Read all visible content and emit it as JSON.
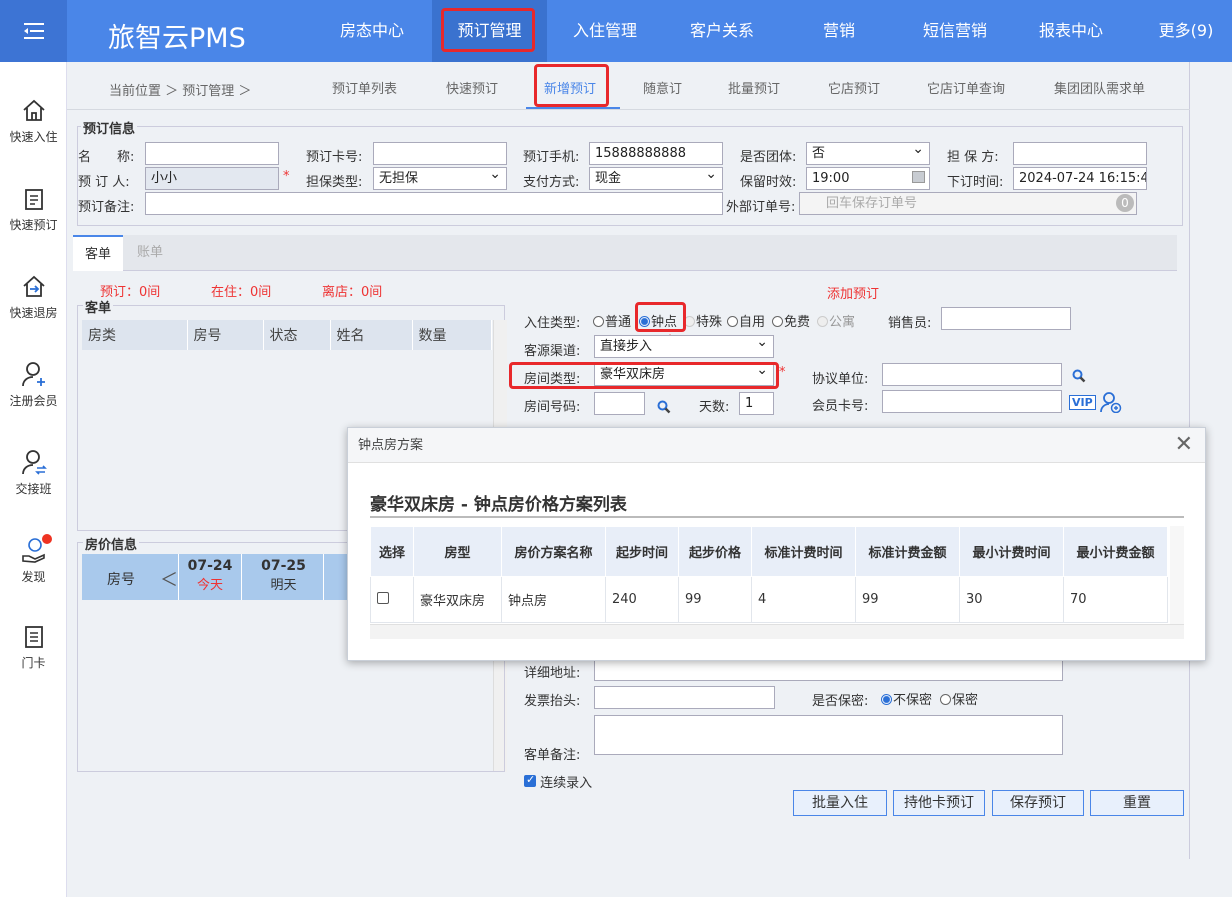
{
  "app": {
    "brand": "旅智云PMS"
  },
  "nav": [
    "房态中心",
    "预订管理",
    "入住管理",
    "客户关系",
    "营销",
    "短信营销",
    "报表中心",
    "更多(9)"
  ],
  "sidebar": [
    "快速入住",
    "快速预订",
    "快速退房",
    "注册会员",
    "交接班",
    "发现",
    "门卡"
  ],
  "breadcrumb": "当前位置 ＞ 预订管理 ＞",
  "subtabs": [
    "预订单列表",
    "快速预订",
    "新增预订",
    "随意订",
    "批量预订",
    "它店预订",
    "它店订单查询",
    "集团团队需求单"
  ],
  "booking": {
    "legend": "预订信息",
    "name_label": "名　　称:",
    "card_label": "预订卡号:",
    "phone_label": "预订手机:",
    "phone": "15888888888",
    "group_label": "是否团体:",
    "group": "否",
    "guarantor_label": "担 保 方:",
    "booker_label": "预 订 人:",
    "booker": "小小",
    "req": "*",
    "guarantee_type_label": "担保类型:",
    "guarantee_type": "无担保",
    "pay_label": "支付方式:",
    "pay": "现金",
    "hold_label": "保留时效:",
    "hold": "19:00",
    "order_time_label": "下订时间:",
    "order_time": "2024-07-24 16:15:4",
    "remark_label": "预订备注:",
    "ext_label": "外部订单号:",
    "ext_placeholder": "回车保存订单号",
    "ext_count": "0"
  },
  "tabs": [
    "客单",
    "账单"
  ],
  "stats": {
    "booked": "预订：0间",
    "inhouse": "在住：0间",
    "away": "离店：0间",
    "add": "添加预订"
  },
  "guest": {
    "legend": "客单",
    "cols": [
      "房类",
      "房号",
      "状态",
      "姓名",
      "数量"
    ]
  },
  "price": {
    "legend": "房价信息",
    "room_label": "房号",
    "prev": "＜",
    "days": [
      {
        "date": "07-24",
        "sub": "今天"
      },
      {
        "date": "07-25",
        "sub": "明天"
      }
    ]
  },
  "form": {
    "checkin_label": "入住类型:",
    "types": [
      "普通",
      "钟点",
      "特殊",
      "自用",
      "免费",
      "公寓"
    ],
    "sales_label": "销售员:",
    "source_label": "客源渠道:",
    "source": "直接步入",
    "agreement_label": "协议单位:",
    "roomtype_label": "房间类型:",
    "roomtype": "豪华双床房",
    "member_label": "会员卡号:",
    "vip": "VIP",
    "roomno_label": "房间号码:",
    "days_label": "天数:",
    "days": "1",
    "address_label": "详细地址:",
    "invoice_label": "发票抬头:",
    "secret_label": "是否保密:",
    "no_secret": "不保密",
    "secret": "保密",
    "note_label": "客单备注:",
    "continuous": "连续录入"
  },
  "buttons": [
    "批量入住",
    "持他卡预订",
    "保存预订",
    "重置"
  ],
  "dialog": {
    "title": "钟点房方案",
    "close": "✕",
    "heading": "豪华双床房 - 钟点房价格方案列表",
    "cols": [
      "选择",
      "房型",
      "房价方案名称",
      "起步时间",
      "起步价格",
      "标准计费时间",
      "标准计费金额",
      "最小计费时间",
      "最小计费金额"
    ],
    "rows": [
      [
        "",
        "豪华双床房",
        "钟点房",
        "240",
        "99",
        "4",
        "99",
        "30",
        "70"
      ]
    ]
  }
}
